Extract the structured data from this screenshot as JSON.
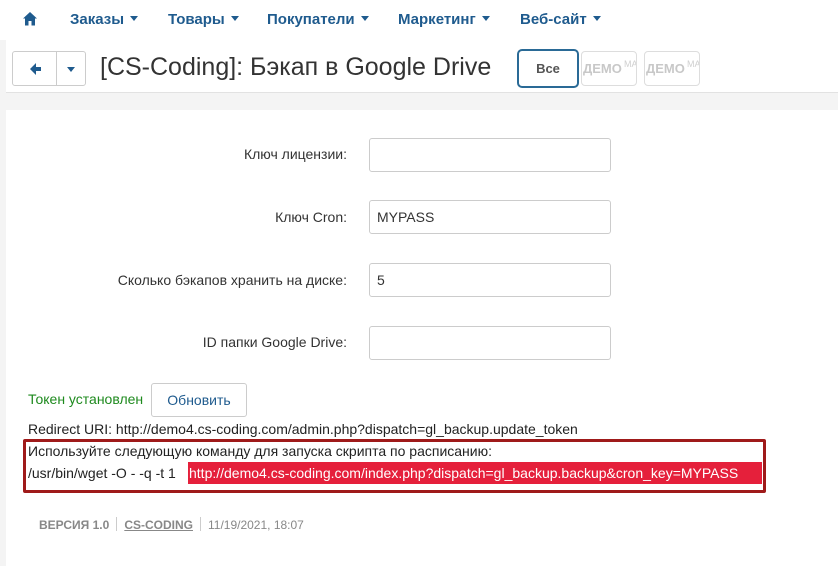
{
  "nav": {
    "home_icon": "home-icon",
    "items": [
      {
        "label": "Заказы"
      },
      {
        "label": "Товары"
      },
      {
        "label": "Покупатели"
      },
      {
        "label": "Маркетинг"
      },
      {
        "label": "Веб-сайт"
      }
    ]
  },
  "titlebar": {
    "back_icon": "arrow-left-icon",
    "title": "[CS-Coding]: Бэкап в Google Drive",
    "all_button": "Все",
    "demo_buttons": [
      {
        "label": "ДЕМО",
        "sub": "MA"
      },
      {
        "label": "ДЕМО",
        "sub": "MA"
      }
    ]
  },
  "form": {
    "license_label": "Ключ лицензии:",
    "license_value": "",
    "cron_label": "Ключ Cron:",
    "cron_value": "MYPASS",
    "keep_label": "Сколько бэкапов хранить на диске:",
    "keep_value": "5",
    "folder_label": "ID папки Google Drive:",
    "folder_value": ""
  },
  "token": {
    "status": "Токен установлен",
    "refresh_button": "Обновить",
    "redirect_uri": "Redirect URI: http://demo4.cs-coding.com/admin.php?dispatch=gl_backup.update_token"
  },
  "cron": {
    "hint": "Используйте следующую команду для запуска скрипта по расписанию:",
    "command": "/usr/bin/wget -O - -q -t 1",
    "url": "http://demo4.cs-coding.com/index.php?dispatch=gl_backup.backup&cron_key=MYPASS"
  },
  "footer": {
    "version": "ВЕРСИЯ 1.0",
    "vendor": "CS-CODING",
    "date": "11/19/2021, 18:07"
  },
  "colors": {
    "nav_text": "#1f5b8e",
    "token_ok": "#1e8a1e",
    "highlight": "#e5203b",
    "box_border": "#9f1a1a"
  }
}
